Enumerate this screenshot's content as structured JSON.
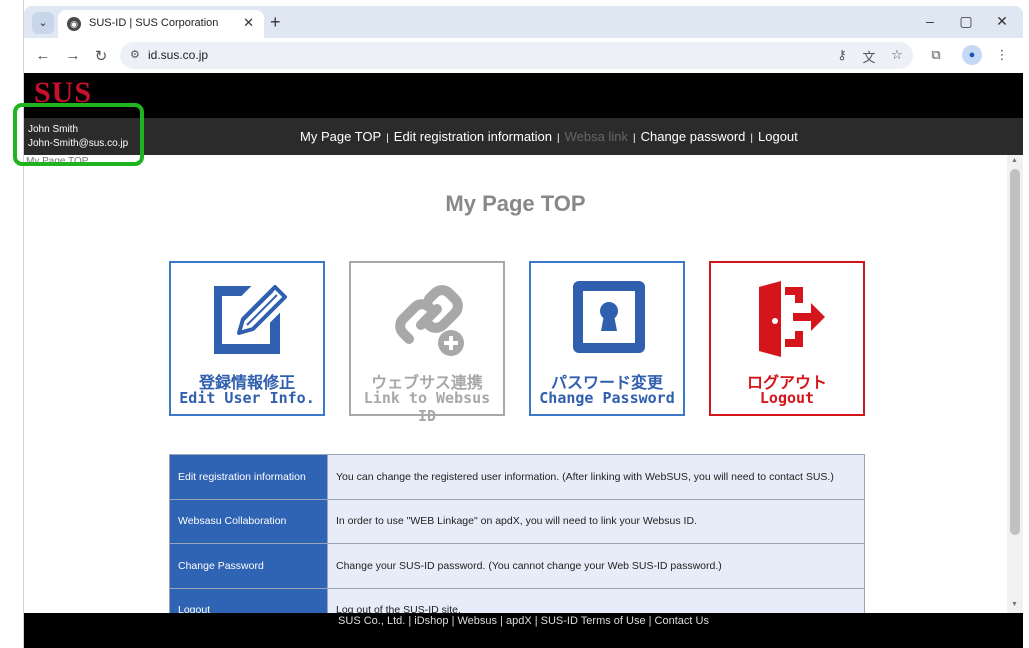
{
  "browser": {
    "tab_title": "SUS-ID | SUS Corporation",
    "url": "id.sus.co.jp"
  },
  "site": {
    "logo": "SUS",
    "user_name": "John Smith",
    "user_email": "John-Smith@sus.co.jp",
    "breadcrumb": "My Page TOP",
    "nav": [
      {
        "label": "My Page TOP"
      },
      {
        "label": "Edit registration information"
      },
      {
        "label": "Websa link"
      },
      {
        "label": "Change password"
      },
      {
        "label": "Logout"
      }
    ]
  },
  "main": {
    "title": "My Page TOP",
    "cards": [
      {
        "ja": "登録情報修正",
        "en": "Edit User Info.",
        "color": "#2f5fae"
      },
      {
        "ja": "ウェブサス連携",
        "en": "Link to Websus ID",
        "color": "#a8a8a8"
      },
      {
        "ja": "パスワード変更",
        "en": "Change Password",
        "color": "#2f5fae"
      },
      {
        "ja": "ログアウト",
        "en": "Logout",
        "color": "#d4161c"
      }
    ],
    "table": [
      {
        "label": "Edit registration information",
        "desc": "You can change the registered user information. (After linking with WebSUS, you will need to contact SUS.)"
      },
      {
        "label": "Websasu Collaboration",
        "desc": "In order to use \"WEB Linkage\" on apdX, you will need to link your Websus ID."
      },
      {
        "label": "Change Password",
        "desc": "Change your SUS-ID password. (You cannot change your Web SUS-ID password.)"
      },
      {
        "label": "Logout",
        "desc": "Log out of the SUS-ID site."
      }
    ]
  },
  "footer": {
    "text": "SUS Co., Ltd. | iDshop | Websus | apdX | SUS-ID Terms of Use | Contact Us"
  }
}
